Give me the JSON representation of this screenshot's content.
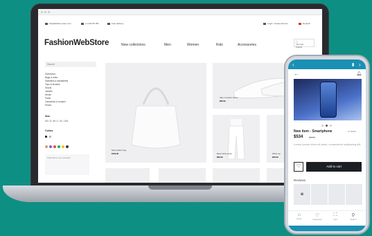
{
  "topbar": {
    "email": "info@fashion-store.com",
    "phone": "+1 234 56 789",
    "delivery": "Free delivery",
    "login": "Login / create account",
    "lang": "Deutsch"
  },
  "store": {
    "logo": "FashionWebStore",
    "nav": [
      "New collections",
      "Men",
      "Women",
      "Kids",
      "Accessories"
    ],
    "cart": [
      "Your cart",
      "0 items"
    ]
  },
  "sidebar": {
    "search_placeholder": "Search",
    "categories": [
      "Outerwear",
      "Bags & totes",
      "Sweaters & sweatshirts",
      "Tops & blouses",
      "Shorts",
      "Jackets",
      "Denim",
      "Pants",
      "Jumpsuits & rompers",
      "Shoes"
    ],
    "size_title": "Size",
    "sizes": "XS / S / M / L / XL / XXL",
    "color_title": "Colors",
    "swatch_colors": [
      "#c9a36b",
      "#9b59b6",
      "#e74c3c",
      "#27ae60",
      "#f1c40f",
      "#2c3e50"
    ],
    "promo": "Subscribe to our newsletter"
  },
  "products": {
    "bag": {
      "label": "Daily leather bag",
      "price": "$159.99"
    },
    "shoes": {
      "label": "Slip-on leather shoes",
      "price": "$89.99"
    },
    "pants": {
      "label": "Basic white pants",
      "price": "$69.99"
    },
    "top": {
      "label": "White top",
      "price": "$39.99"
    }
  },
  "phone": {
    "product_title": "New item - Smartphone",
    "stock": "In stock",
    "price": "$534",
    "old_price": "$799",
    "description": "Lorem ipsum dolor sit amet, consectetur adipiscing elit.",
    "add_to_cart": "Add to cart",
    "reviews_title": "Reviews",
    "tabs": [
      {
        "icon": "⌂",
        "label": "Home"
      },
      {
        "icon": "♡",
        "label": "Favourites"
      },
      {
        "icon": "⛶",
        "label": "Cart"
      },
      {
        "icon": "⚲",
        "label": "Search"
      }
    ],
    "accent": "#1a90b4"
  }
}
